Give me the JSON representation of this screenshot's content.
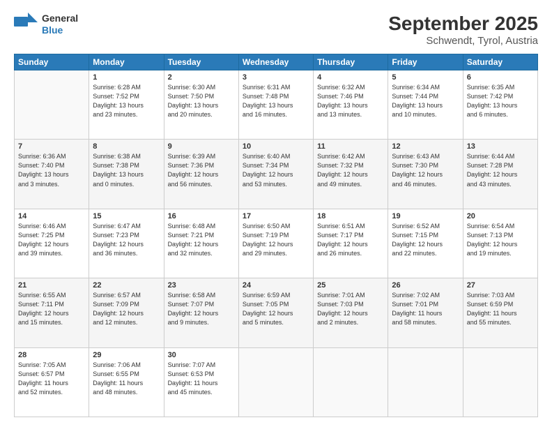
{
  "logo": {
    "line1": "General",
    "line2": "Blue"
  },
  "title": "September 2025",
  "subtitle": "Schwendt, Tyrol, Austria",
  "weekdays": [
    "Sunday",
    "Monday",
    "Tuesday",
    "Wednesday",
    "Thursday",
    "Friday",
    "Saturday"
  ],
  "weeks": [
    [
      {
        "day": "",
        "info": ""
      },
      {
        "day": "1",
        "info": "Sunrise: 6:28 AM\nSunset: 7:52 PM\nDaylight: 13 hours\nand 23 minutes."
      },
      {
        "day": "2",
        "info": "Sunrise: 6:30 AM\nSunset: 7:50 PM\nDaylight: 13 hours\nand 20 minutes."
      },
      {
        "day": "3",
        "info": "Sunrise: 6:31 AM\nSunset: 7:48 PM\nDaylight: 13 hours\nand 16 minutes."
      },
      {
        "day": "4",
        "info": "Sunrise: 6:32 AM\nSunset: 7:46 PM\nDaylight: 13 hours\nand 13 minutes."
      },
      {
        "day": "5",
        "info": "Sunrise: 6:34 AM\nSunset: 7:44 PM\nDaylight: 13 hours\nand 10 minutes."
      },
      {
        "day": "6",
        "info": "Sunrise: 6:35 AM\nSunset: 7:42 PM\nDaylight: 13 hours\nand 6 minutes."
      }
    ],
    [
      {
        "day": "7",
        "info": "Sunrise: 6:36 AM\nSunset: 7:40 PM\nDaylight: 13 hours\nand 3 minutes."
      },
      {
        "day": "8",
        "info": "Sunrise: 6:38 AM\nSunset: 7:38 PM\nDaylight: 13 hours\nand 0 minutes."
      },
      {
        "day": "9",
        "info": "Sunrise: 6:39 AM\nSunset: 7:36 PM\nDaylight: 12 hours\nand 56 minutes."
      },
      {
        "day": "10",
        "info": "Sunrise: 6:40 AM\nSunset: 7:34 PM\nDaylight: 12 hours\nand 53 minutes."
      },
      {
        "day": "11",
        "info": "Sunrise: 6:42 AM\nSunset: 7:32 PM\nDaylight: 12 hours\nand 49 minutes."
      },
      {
        "day": "12",
        "info": "Sunrise: 6:43 AM\nSunset: 7:30 PM\nDaylight: 12 hours\nand 46 minutes."
      },
      {
        "day": "13",
        "info": "Sunrise: 6:44 AM\nSunset: 7:28 PM\nDaylight: 12 hours\nand 43 minutes."
      }
    ],
    [
      {
        "day": "14",
        "info": "Sunrise: 6:46 AM\nSunset: 7:25 PM\nDaylight: 12 hours\nand 39 minutes."
      },
      {
        "day": "15",
        "info": "Sunrise: 6:47 AM\nSunset: 7:23 PM\nDaylight: 12 hours\nand 36 minutes."
      },
      {
        "day": "16",
        "info": "Sunrise: 6:48 AM\nSunset: 7:21 PM\nDaylight: 12 hours\nand 32 minutes."
      },
      {
        "day": "17",
        "info": "Sunrise: 6:50 AM\nSunset: 7:19 PM\nDaylight: 12 hours\nand 29 minutes."
      },
      {
        "day": "18",
        "info": "Sunrise: 6:51 AM\nSunset: 7:17 PM\nDaylight: 12 hours\nand 26 minutes."
      },
      {
        "day": "19",
        "info": "Sunrise: 6:52 AM\nSunset: 7:15 PM\nDaylight: 12 hours\nand 22 minutes."
      },
      {
        "day": "20",
        "info": "Sunrise: 6:54 AM\nSunset: 7:13 PM\nDaylight: 12 hours\nand 19 minutes."
      }
    ],
    [
      {
        "day": "21",
        "info": "Sunrise: 6:55 AM\nSunset: 7:11 PM\nDaylight: 12 hours\nand 15 minutes."
      },
      {
        "day": "22",
        "info": "Sunrise: 6:57 AM\nSunset: 7:09 PM\nDaylight: 12 hours\nand 12 minutes."
      },
      {
        "day": "23",
        "info": "Sunrise: 6:58 AM\nSunset: 7:07 PM\nDaylight: 12 hours\nand 9 minutes."
      },
      {
        "day": "24",
        "info": "Sunrise: 6:59 AM\nSunset: 7:05 PM\nDaylight: 12 hours\nand 5 minutes."
      },
      {
        "day": "25",
        "info": "Sunrise: 7:01 AM\nSunset: 7:03 PM\nDaylight: 12 hours\nand 2 minutes."
      },
      {
        "day": "26",
        "info": "Sunrise: 7:02 AM\nSunset: 7:01 PM\nDaylight: 11 hours\nand 58 minutes."
      },
      {
        "day": "27",
        "info": "Sunrise: 7:03 AM\nSunset: 6:59 PM\nDaylight: 11 hours\nand 55 minutes."
      }
    ],
    [
      {
        "day": "28",
        "info": "Sunrise: 7:05 AM\nSunset: 6:57 PM\nDaylight: 11 hours\nand 52 minutes."
      },
      {
        "day": "29",
        "info": "Sunrise: 7:06 AM\nSunset: 6:55 PM\nDaylight: 11 hours\nand 48 minutes."
      },
      {
        "day": "30",
        "info": "Sunrise: 7:07 AM\nSunset: 6:53 PM\nDaylight: 11 hours\nand 45 minutes."
      },
      {
        "day": "",
        "info": ""
      },
      {
        "day": "",
        "info": ""
      },
      {
        "day": "",
        "info": ""
      },
      {
        "day": "",
        "info": ""
      }
    ]
  ]
}
